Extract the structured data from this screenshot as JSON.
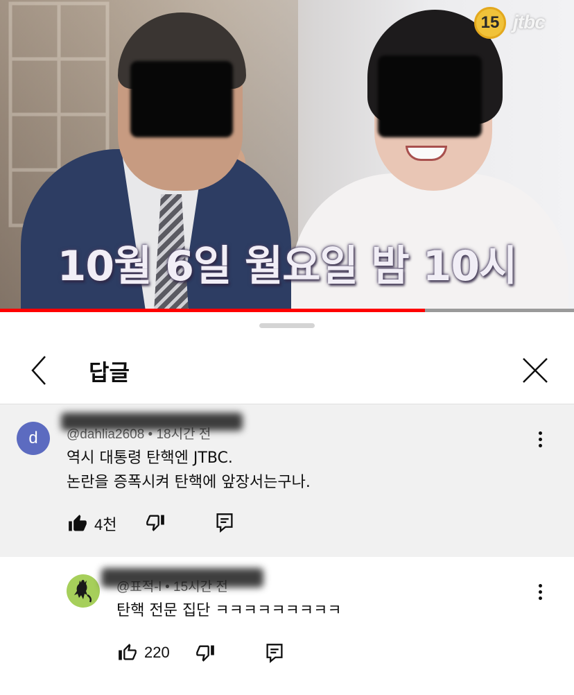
{
  "video": {
    "caption": "10월 6일 월요일 밤 10시",
    "rating": "15",
    "channel_logo": "jtbc",
    "progress_fraction": 0.74,
    "progress_color": "#ff0000"
  },
  "sheet": {
    "title": "답글",
    "back_icon": "chevron-left-icon",
    "close_icon": "close-icon"
  },
  "parent_comment": {
    "avatar_letter": "d",
    "avatar_color": "#5c6bc0",
    "author": "@dahlia2608",
    "time": "18시간 전",
    "lines": [
      "역시 대통령 탄핵엔 JTBC.",
      "논란을 증폭시켜 탄핵에 앞장서는구나."
    ],
    "likes": "4천",
    "liked": true,
    "icons": [
      "thumbs-up-icon",
      "thumbs-down-icon",
      "reply-icon",
      "more-vert-icon"
    ]
  },
  "reply": {
    "author": "@표적-l",
    "time": "15시간 전",
    "text": "탄핵 전문 집단 ㅋㅋㅋㅋㅋㅋㅋㅋㅋ",
    "likes": "220",
    "liked": false,
    "avatar_color": "#a6cf5b",
    "icons": [
      "thumbs-up-icon",
      "thumbs-down-icon",
      "reply-icon",
      "more-vert-icon"
    ]
  }
}
